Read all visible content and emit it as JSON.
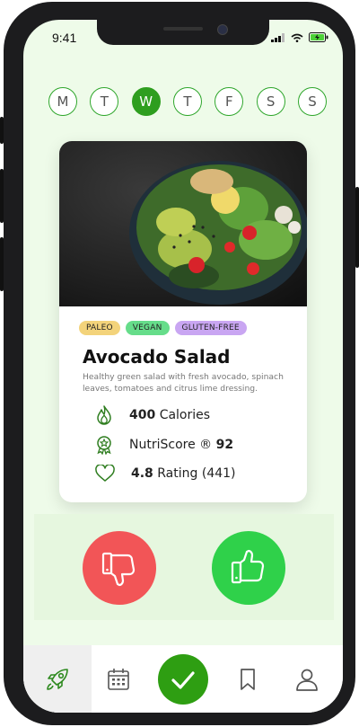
{
  "status": {
    "time": "9:41"
  },
  "days": [
    {
      "label": "M",
      "active": false
    },
    {
      "label": "T",
      "active": false
    },
    {
      "label": "W",
      "active": true
    },
    {
      "label": "T",
      "active": false
    },
    {
      "label": "F",
      "active": false
    },
    {
      "label": "S",
      "active": false
    },
    {
      "label": "S",
      "active": false
    }
  ],
  "card": {
    "tags": [
      {
        "label": "PALEO",
        "color": "#f3d37b"
      },
      {
        "label": "VEGAN",
        "color": "#66dd8a"
      },
      {
        "label": "GLUTEN-FREE",
        "color": "#c9a6f2"
      }
    ],
    "title": "Avocado Salad",
    "description": "Healthy green salad with fresh avocado, spinach leaves, tomatoes and citrus lime dressing.",
    "calories_value": "400",
    "calories_label": "Calories",
    "nutri_label": "NutriScore ®",
    "nutri_value": "92",
    "rating_value": "4.8",
    "rating_label": "Rating (441)"
  },
  "colors": {
    "accent": "#2e9e1f",
    "dislike": "#f25557",
    "like": "#2fd14a",
    "background": "#eefbe9"
  },
  "tabbar": {
    "items": [
      {
        "icon": "rocket-icon",
        "active": true
      },
      {
        "icon": "calendar-icon",
        "active": false
      },
      {
        "icon": "check-icon",
        "active": false
      },
      {
        "icon": "bookmark-icon",
        "active": false
      },
      {
        "icon": "profile-icon",
        "active": false
      }
    ]
  }
}
